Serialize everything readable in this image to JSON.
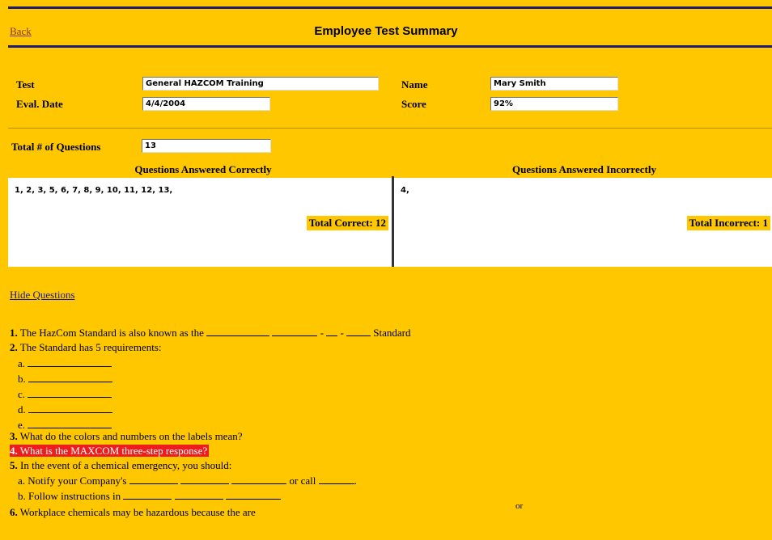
{
  "header": {
    "back_label": "Back",
    "title": "Employee Test Summary"
  },
  "form": {
    "test_label": "Test",
    "test_value": "General HAZCOM Training",
    "name_label": "Name",
    "name_value": "Mary Smith",
    "date_label": "Eval. Date",
    "date_value": "4/4/2004",
    "score_label": "Score",
    "score_value": "92%",
    "total_label": "Total # of Questions",
    "total_value": "13"
  },
  "results": {
    "correct_header": "Questions Answered Correctly",
    "incorrect_header": "Questions Answered Incorrectly",
    "correct_list": "1, 2, 3, 5, 6, 7, 8, 9, 10, 11, 12, 13,",
    "incorrect_list": "4,",
    "total_correct": "Total Correct: 12",
    "total_incorrect": "Total Incorrect: 1"
  },
  "hide_questions_label": "Hide Questions",
  "questions": {
    "q1_num": "1.",
    "q1_text": "The HazCom Standard is also known as the",
    "q1_end": "Standard",
    "q2_num": "2.",
    "q2_text": "The Standard has 5 requirements:",
    "q2_a": "a.",
    "q2_b": "b.",
    "q2_c": "c.",
    "q2_d": "d.",
    "q2_e": "e.",
    "q3_num": "3.",
    "q3_text": "What do the colors and numbers on the labels mean?",
    "q4_num": "4.",
    "q4_text": "What is the MAXCOM three-step response?",
    "q5_num": "5.",
    "q5_text": "In the event of a chemical emergency, you should:",
    "q5_a": "a. Notify your Company's",
    "q5_a_or": "or call",
    "q5_b": "b. Follow instructions in",
    "q6_num": "6.",
    "q6_text": "Workplace chemicals may be hazardous because the are",
    "q6_or": "or"
  },
  "colors": {
    "background": "#fec700",
    "highlight": "#ee1d1d",
    "rule": "#1c1c78"
  }
}
